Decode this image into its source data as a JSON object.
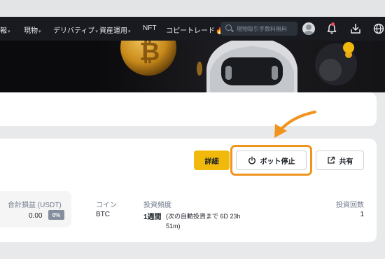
{
  "nav": {
    "items": [
      {
        "label": "報",
        "caret": true
      },
      {
        "label": "現物",
        "caret": true
      },
      {
        "label": "デリバティブ",
        "caret": true
      },
      {
        "label": "資産運用",
        "caret": true
      },
      {
        "label": "NFT",
        "caret": false
      },
      {
        "label": "コピートレード",
        "caret": false
      }
    ],
    "caret_glyph": "▾",
    "fire_glyph": "🔥",
    "search_placeholder": "現物取引手数料無料",
    "icons": [
      "search-icon",
      "avatar",
      "bell-icon",
      "download-icon",
      "globe-icon"
    ]
  },
  "bot": {
    "buttons": {
      "detail": "詳細",
      "stop": "ボット停止",
      "share": "共有"
    },
    "pnl": {
      "label": "合計損益 (USDT)",
      "value": "0.00",
      "percent": "0%"
    },
    "coin": {
      "label": "コイン",
      "value": "BTC"
    },
    "frequency": {
      "label": "投資頻度",
      "value": "1週間",
      "note": "(次の自動投資まで 6D 23h",
      "note_cont": "51m)"
    },
    "count": {
      "label": "投資回数",
      "value": "1"
    }
  },
  "colors": {
    "accent": "#f0b90b",
    "highlight": "#f0941e",
    "navbar": "#181a20"
  }
}
